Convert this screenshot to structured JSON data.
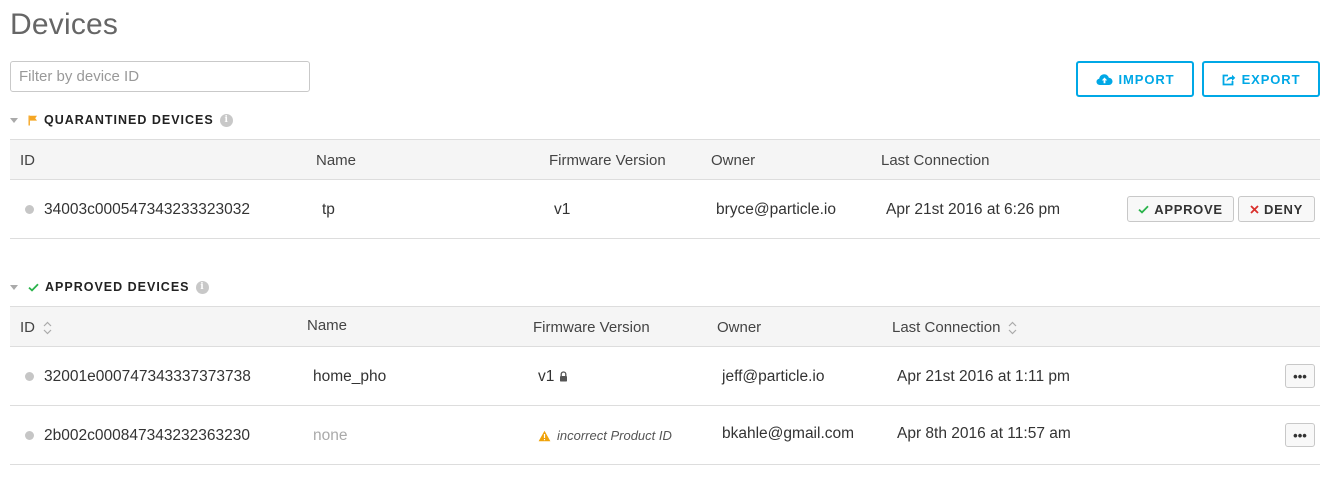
{
  "page": {
    "title": "Devices"
  },
  "filter": {
    "placeholder": "Filter by device ID",
    "value": ""
  },
  "toolbar": {
    "import_label": "IMPORT",
    "export_label": "EXPORT"
  },
  "colors": {
    "accent": "#00a8e6",
    "flag": "#f5a623",
    "approve": "#2ab34b",
    "deny": "#d9302c",
    "warning": "#f0a30a"
  },
  "quarantined": {
    "title": "QUARANTINED DEVICES",
    "icon": "flag-icon",
    "columns": {
      "id": "ID",
      "name": "Name",
      "firmware": "Firmware Version",
      "owner": "Owner",
      "last": "Last Connection"
    },
    "rows": [
      {
        "id": "34003c000547343233323032",
        "name": "tp",
        "firmware": "v1",
        "owner": "bryce@particle.io",
        "last": "Apr 21st 2016 at 6:26 pm",
        "approve_label": "APPROVE",
        "deny_label": "DENY"
      }
    ]
  },
  "approved": {
    "title": "APPROVED DEVICES",
    "icon": "check-icon",
    "columns": {
      "id": "ID",
      "name": "Name",
      "firmware": "Firmware Version",
      "owner": "Owner",
      "last": "Last Connection"
    },
    "rows": [
      {
        "id": "32001e000747343337373738",
        "name": "home_pho",
        "firmware": "v1",
        "firmware_locked": true,
        "owner": "jeff@particle.io",
        "last": "Apr 21st 2016 at 1:11 pm",
        "more_label": "•••"
      },
      {
        "id": "2b002c000847343232363230",
        "name": "none",
        "firmware": "incorrect Product ID",
        "firmware_warning": true,
        "owner": "bkahle@gmail.com",
        "last": "Apr 8th 2016 at 11:57 am",
        "more_label": "•••"
      }
    ]
  }
}
